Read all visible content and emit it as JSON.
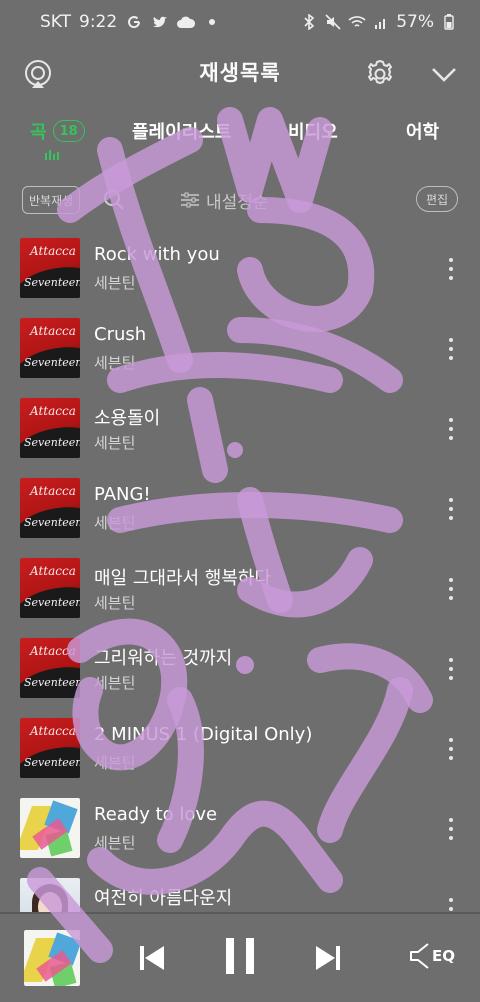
{
  "status_bar": {
    "carrier": "SKT",
    "time": "9:22",
    "battery": "57%",
    "left_icons": [
      "google-icon",
      "twitter-icon",
      "cloud-icon",
      "dot-icon"
    ],
    "right_icons": [
      "bluetooth-icon",
      "mute-icon",
      "wifi-icon",
      "signal-icon",
      "battery-icon"
    ]
  },
  "header": {
    "title": "재생목록"
  },
  "tabs": [
    {
      "label": "곡",
      "badge": "18",
      "active": true
    },
    {
      "label": "플레이리스트"
    },
    {
      "label": "비디오"
    },
    {
      "label": "어학"
    }
  ],
  "toolbar": {
    "repeat_label": "반복재생",
    "sort_label": "내설정순",
    "edit_label": "편집"
  },
  "songs": [
    {
      "title": "Rock with you",
      "artist": "세븐틴",
      "art": "attacca"
    },
    {
      "title": "Crush",
      "artist": "세븐틴",
      "art": "attacca"
    },
    {
      "title": "소용돌이",
      "artist": "세븐틴",
      "art": "attacca"
    },
    {
      "title": "PANG!",
      "artist": "세븐틴",
      "art": "attacca"
    },
    {
      "title": "매일 그대라서 행복하다",
      "artist": "세븐틴",
      "art": "attacca"
    },
    {
      "title": "그리워하는 것까지",
      "artist": "세븐틴",
      "art": "attacca"
    },
    {
      "title": "2 MINUS 1 (Digital Only)",
      "artist": "세븐틴",
      "art": "attacca"
    },
    {
      "title": "Ready to love",
      "artist": "세븐틴",
      "art": "choice"
    },
    {
      "title": "여전히 아름다운지",
      "artist": "",
      "art": "portrait"
    }
  ],
  "album_art_text": {
    "attacca_title": "Attacca",
    "attacca_artist": "Seventeen"
  },
  "player": {
    "progress": 0.0,
    "eq_label": "EQ"
  },
  "colors": {
    "accent": "#34c45a",
    "progress": "#22b84a",
    "background": "#6e6e6e",
    "scribble": "#c99ad8"
  }
}
